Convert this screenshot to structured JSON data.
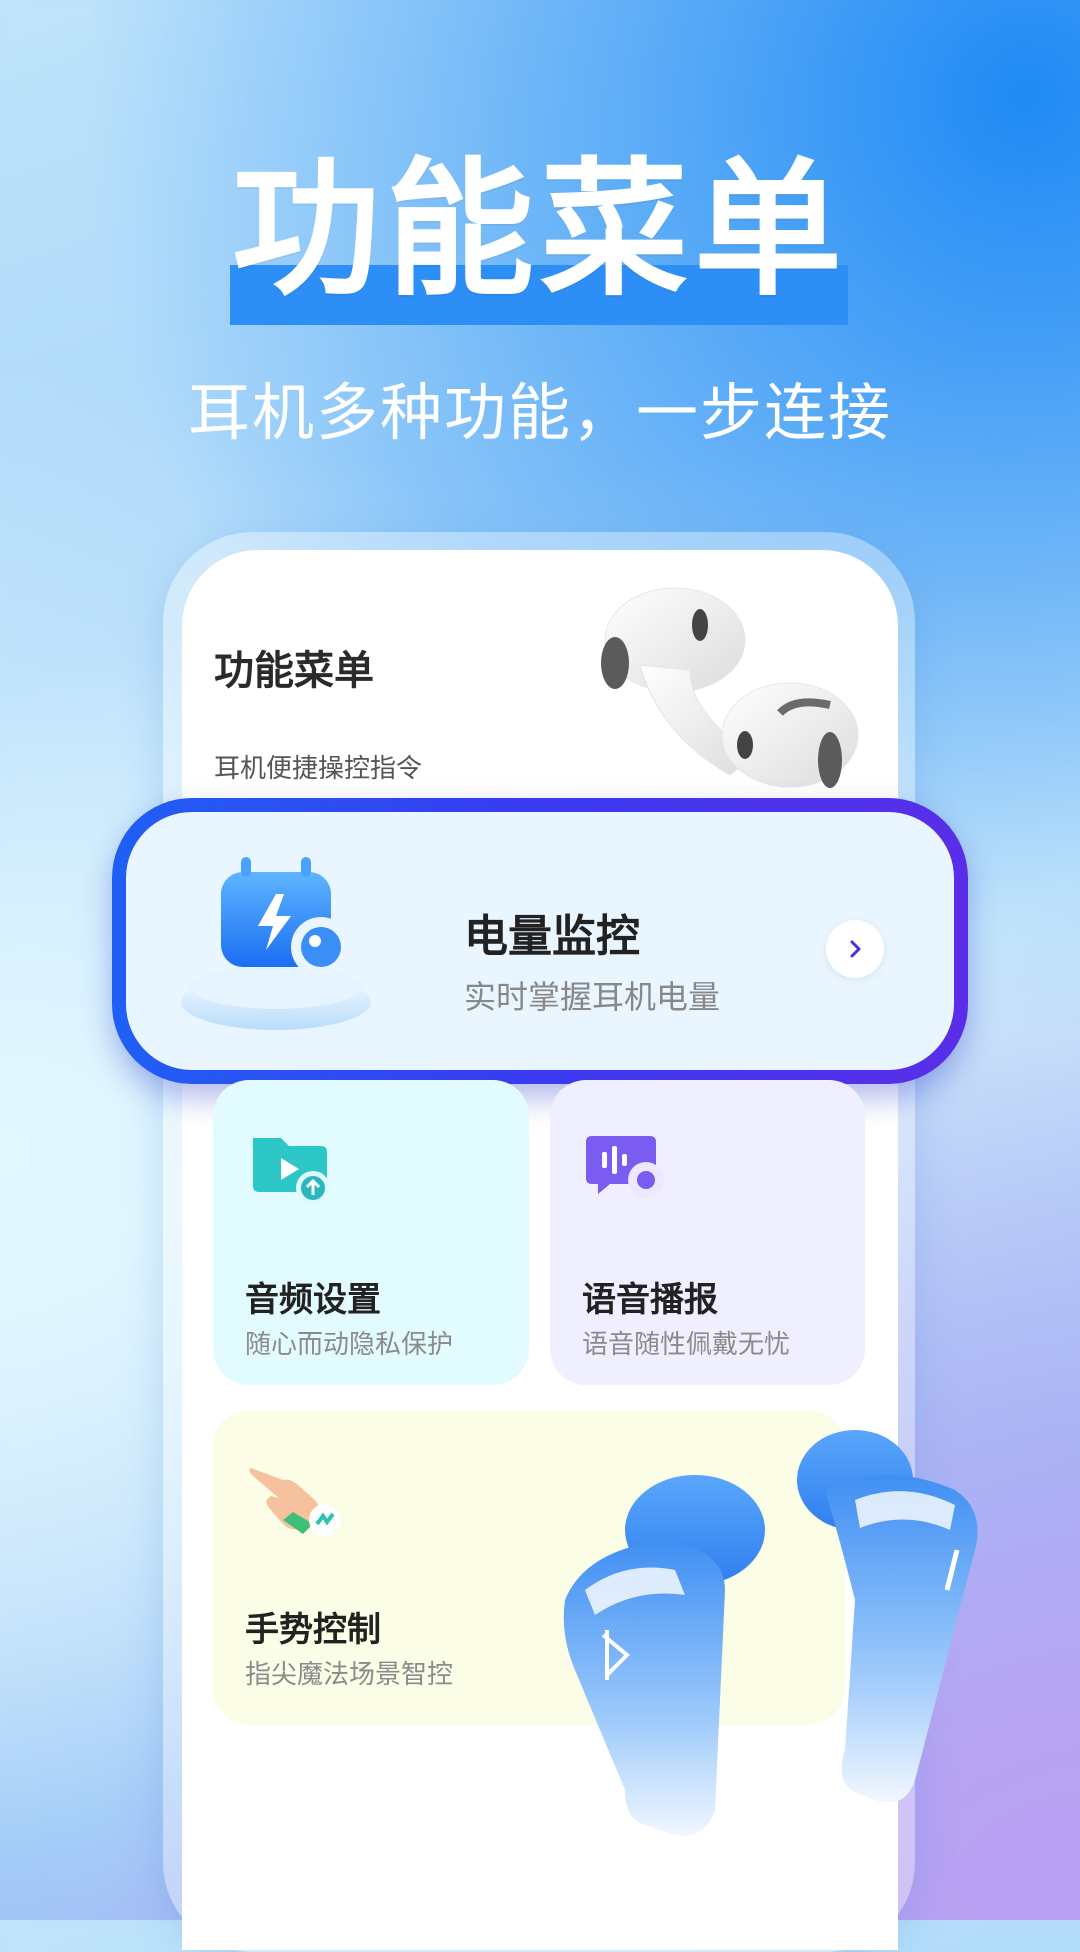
{
  "hero": {
    "title": "功能菜单",
    "subtitle": "耳机多种功能，一步连接"
  },
  "screen": {
    "title": "功能菜单",
    "subtitle": "耳机便捷操控指令"
  },
  "battery_card": {
    "title": "电量监控",
    "description": "实时掌握耳机电量"
  },
  "tiles": [
    {
      "title": "音频设置",
      "description": "随心而动隐私保护"
    },
    {
      "title": "语音播报",
      "description": "语音随性佩戴无忧"
    },
    {
      "title": "手势控制",
      "description": "指尖魔法场景智控"
    }
  ],
  "colors": {
    "accent_blue": "#2d8ef5",
    "card_border_start": "#1f5ff5",
    "card_border_end": "#5a2ee8"
  }
}
